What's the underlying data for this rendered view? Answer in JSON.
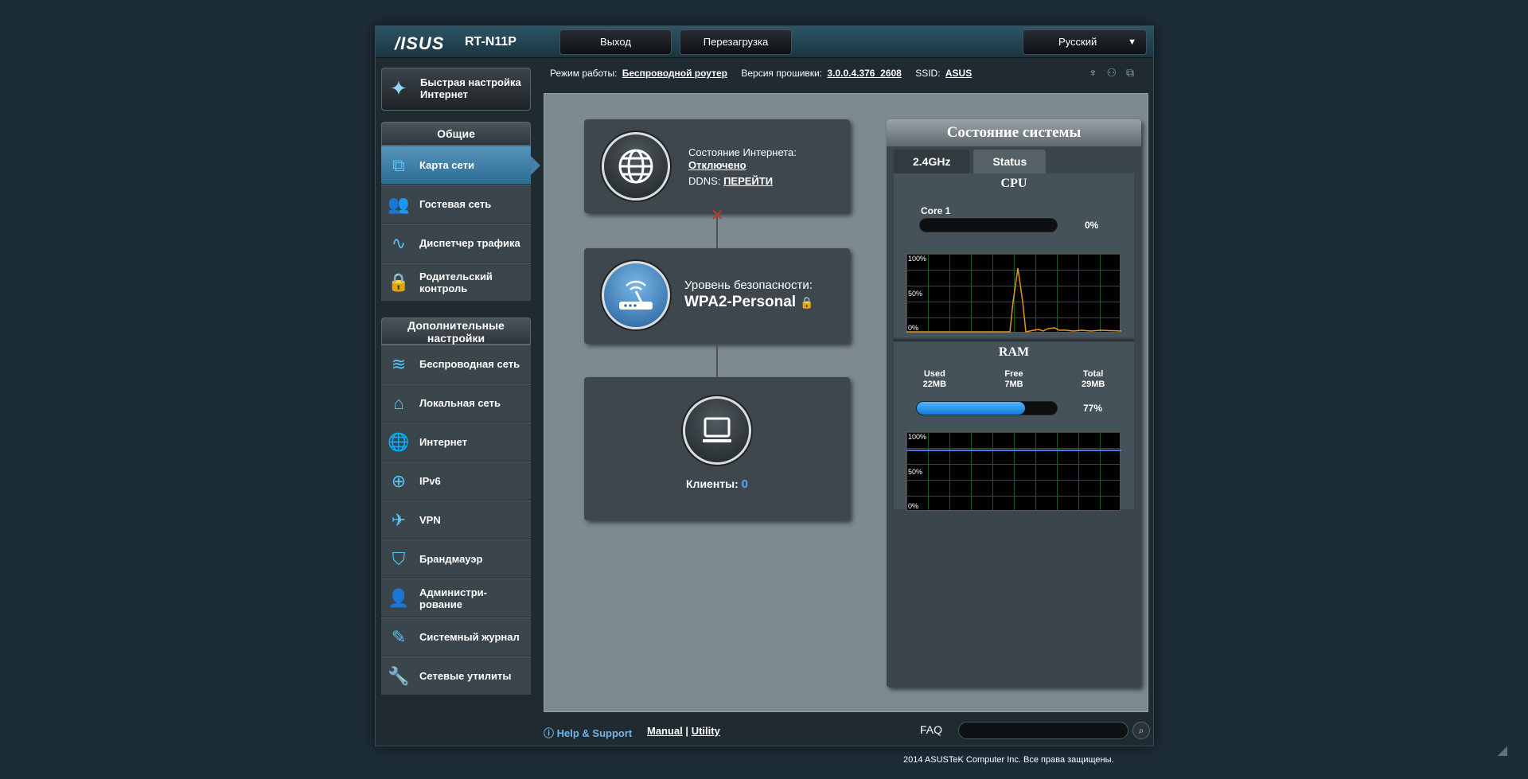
{
  "header": {
    "logo": "/ISUS",
    "model": "RT-N11P",
    "logout_label": "Выход",
    "reboot_label": "Перезагрузка",
    "language": "Русский"
  },
  "info": {
    "mode_label": "Режим работы:",
    "mode_value": "Беспроводной роутер",
    "fw_label": "Версия прошивки:",
    "fw_value": "3.0.0.4.376_2608",
    "ssid_label": "SSID:",
    "ssid_value": "ASUS"
  },
  "sidebar": {
    "quick_label": "Быстрая настройка Интернет",
    "general_header": "Общие",
    "general_items": [
      {
        "label": "Карта сети",
        "icon": "network-map-icon",
        "glyph": "⧉"
      },
      {
        "label": "Гостевая сеть",
        "icon": "guest-network-icon",
        "glyph": "👥"
      },
      {
        "label": "Диспетчер трафика",
        "icon": "traffic-manager-icon",
        "glyph": "∿"
      },
      {
        "label": "Родительский контроль",
        "icon": "parental-lock-icon",
        "glyph": "🔒"
      }
    ],
    "advanced_header": "Дополнительные настройки",
    "advanced_items": [
      {
        "label": "Беспроводная сеть",
        "icon": "wireless-icon",
        "glyph": "≋"
      },
      {
        "label": "Локальная сеть",
        "icon": "home-lan-icon",
        "glyph": "⌂"
      },
      {
        "label": "Интернет",
        "icon": "globe-icon",
        "glyph": "🌐"
      },
      {
        "label": "IPv6",
        "icon": "ipv6-icon",
        "glyph": "⊕"
      },
      {
        "label": "VPN",
        "icon": "vpn-icon",
        "glyph": "✈"
      },
      {
        "label": "Брандмауэр",
        "icon": "firewall-shield-icon",
        "glyph": "⛉"
      },
      {
        "label": "Администри-рование",
        "icon": "admin-user-icon",
        "glyph": "👤"
      },
      {
        "label": "Системный журнал",
        "icon": "system-log-icon",
        "glyph": "✎"
      },
      {
        "label": "Сетевые утилиты",
        "icon": "network-tools-icon",
        "glyph": "🔧"
      }
    ]
  },
  "map": {
    "internet_status_label": "Состояние Интернета:",
    "internet_status_value": "Отключено",
    "ddns_label": "DDNS:",
    "ddns_link": "ПЕРЕЙТИ",
    "security_label": "Уровень безопасности:",
    "security_value": "WPA2-Personal",
    "clients_label": "Клиенты:",
    "clients_count": "0"
  },
  "status_panel": {
    "title": "Состояние системы",
    "tabs": [
      "2.4GHz",
      "Status"
    ],
    "cpu_title": "CPU",
    "core_label": "Core 1",
    "core_percent": "0%",
    "core_value": 0,
    "ram_title": "RAM",
    "used_label": "Used",
    "used_value": "22MB",
    "free_label": "Free",
    "free_value": "7MB",
    "total_label": "Total",
    "total_value": "29MB",
    "ram_percent": "77%",
    "ram_value": 0.77,
    "graph_labels": [
      "100%",
      "50%",
      "0%"
    ]
  },
  "footer": {
    "help": "Help & Support",
    "manual": "Manual",
    "separator": "|",
    "utility": "Utility",
    "faq": "FAQ",
    "copyright": "2014  ASUSTeK Computer Inc. Все права защищены."
  },
  "colors": {
    "accent": "#56c4f3",
    "cpu_line": "#e8951c",
    "ram_line": "#3d7fd8",
    "disconnected": "#c0392b"
  }
}
